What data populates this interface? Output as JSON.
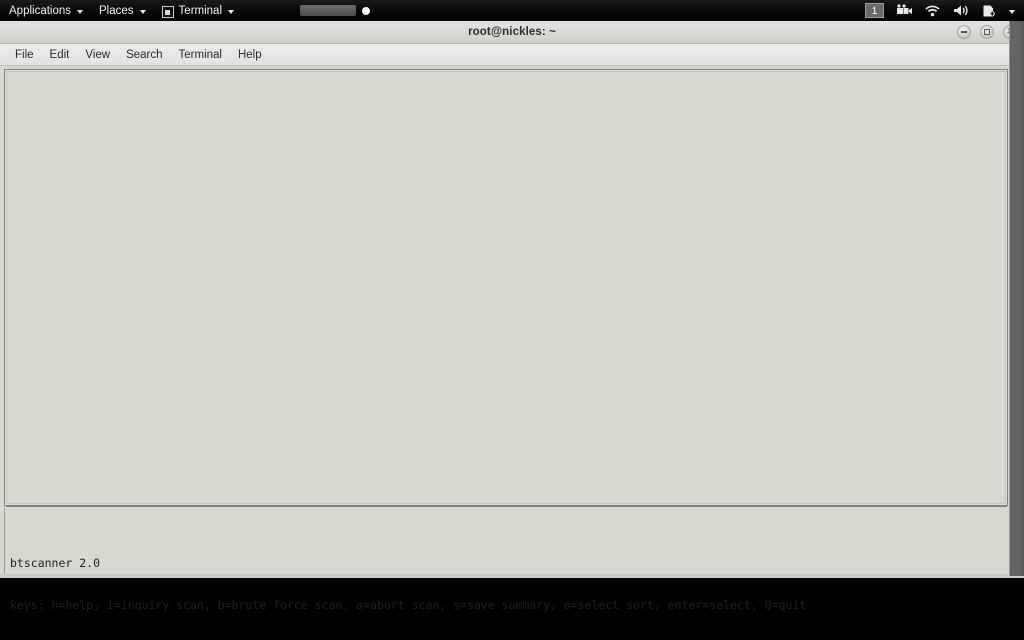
{
  "top_panel": {
    "menus": [
      {
        "label": "Applications",
        "icon": null,
        "caret": true
      },
      {
        "label": "Places",
        "icon": null,
        "caret": true
      },
      {
        "label": "Terminal",
        "icon": "terminal-window-icon",
        "caret": true
      }
    ],
    "center_indicator": {
      "icon": "recording-bar-indicator",
      "dot": "record-dot-icon"
    },
    "tray": {
      "workspace_label": "1",
      "icons": [
        "screencast-camera-icon",
        "wifi-signal-icon",
        "volume-speaker-icon",
        "power-battery-icon",
        "system-menu-caret-icon"
      ]
    }
  },
  "window": {
    "title": "root@nickles: ~",
    "controls": {
      "minimize": "minimize-button",
      "maximize": "maximize-button",
      "close": "close-button"
    }
  },
  "menubar": {
    "items": [
      "File",
      "Edit",
      "View",
      "Search",
      "Terminal",
      "Help"
    ]
  },
  "terminal": {
    "background_color": "#d5d9d0",
    "foreground_color": "#1d211c",
    "app_banner": "btscanner 2.0",
    "keys_line": "keys: h=help, i=inquiry scan, b=brute force scan, a=abort scan, s=save summary, o=select sort, enter=select, Q=quit",
    "panel_content": ""
  }
}
